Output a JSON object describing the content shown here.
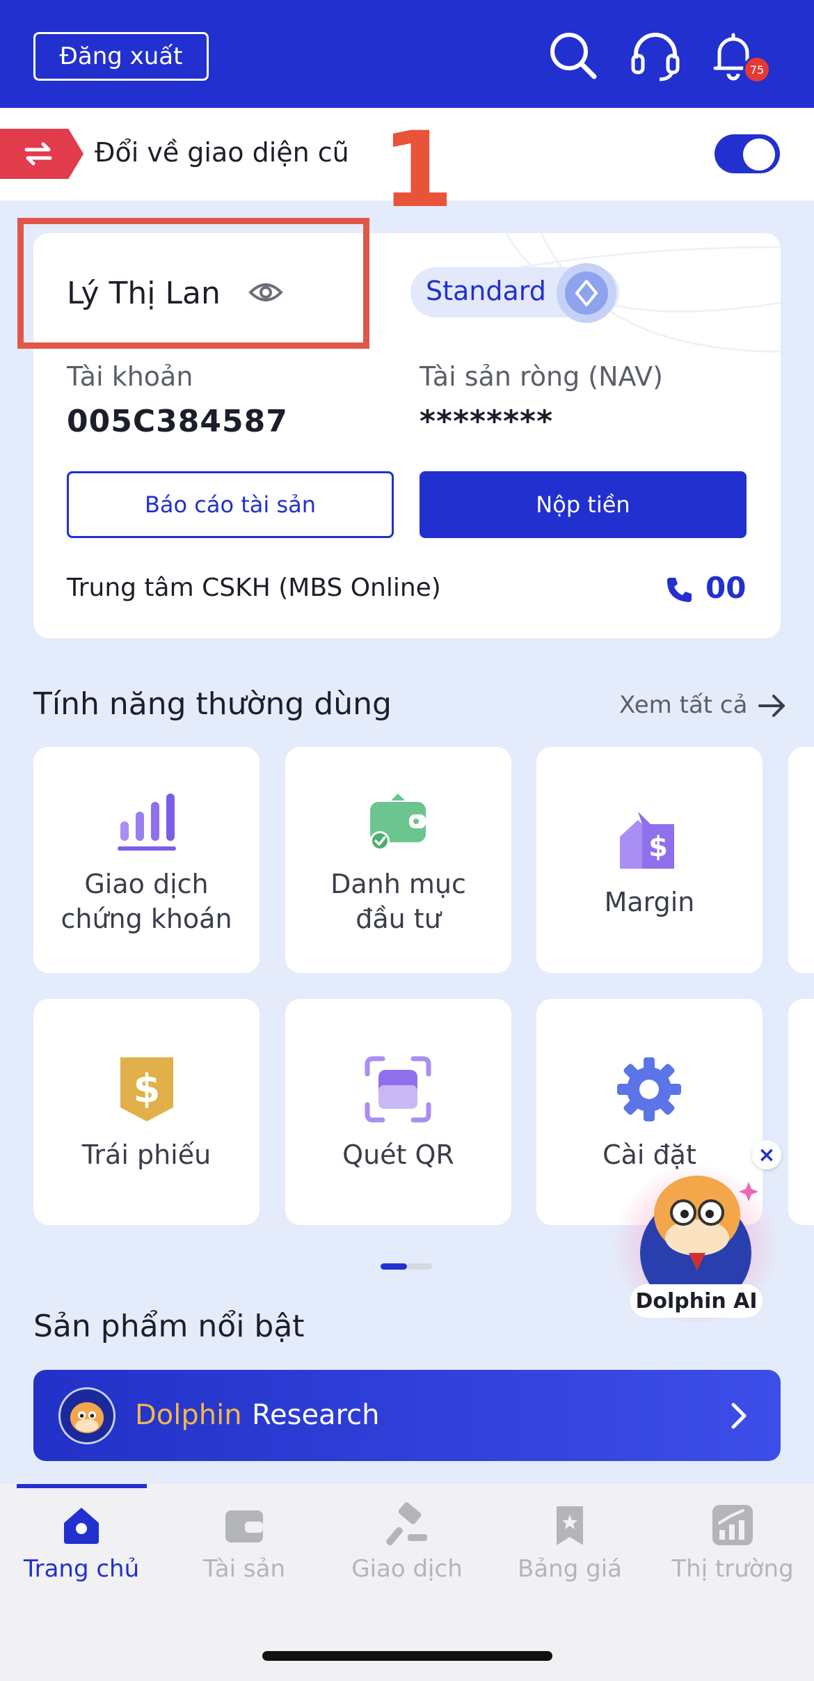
{
  "header": {
    "logout_label": "Đăng xuất",
    "notification_count": "75"
  },
  "switch_bar": {
    "label": "Đổi về giao diện cũ",
    "toggle_on": true
  },
  "annotation": {
    "step_number": "1"
  },
  "account": {
    "name": "Lý Thị Lan",
    "tier": "Standard",
    "account_label": "Tài khoản",
    "account_number": "005C384587",
    "nav_label": "Tài sản ròng (NAV)",
    "nav_value": "********",
    "report_button": "Báo cáo tài sản",
    "deposit_button": "Nộp tiền",
    "support_label": "Trung tâm CSKH (MBS Online)",
    "support_number": "00"
  },
  "features": {
    "title": "Tính năng thường dùng",
    "see_all": "Xem tất cả",
    "items": [
      {
        "line1": "Giao dịch",
        "line2": "chứng khoán",
        "icon": "bar-chart-icon"
      },
      {
        "line1": "Danh mục",
        "line2": "đầu tư",
        "icon": "wallet-icon"
      },
      {
        "line1": "Margin",
        "line2": "",
        "icon": "margin-house-icon"
      },
      {
        "line1": "Trái phiếu",
        "line2": "",
        "icon": "bond-dollar-icon"
      },
      {
        "line1": "Quét QR",
        "line2": "",
        "icon": "qr-scan-icon"
      },
      {
        "line1": "Cài đặt",
        "line2": "",
        "icon": "gear-icon"
      }
    ]
  },
  "featured": {
    "title": "Sản phẩm nổi bật",
    "banner_word1": "Dolphin",
    "banner_word2": "Research"
  },
  "dolphin_ai": {
    "label": "Dolphin AI",
    "close": "×"
  },
  "tabs": [
    {
      "label": "Trang chủ",
      "active": true,
      "icon": "home-icon"
    },
    {
      "label": "Tài sản",
      "active": false,
      "icon": "wallet-icon"
    },
    {
      "label": "Giao dịch",
      "active": false,
      "icon": "gavel-icon"
    },
    {
      "label": "Bảng giá",
      "active": false,
      "icon": "bookmark-star-icon"
    },
    {
      "label": "Thị trường",
      "active": false,
      "icon": "market-chart-icon"
    }
  ],
  "colors": {
    "primary": "#2130cf",
    "accent_red": "#e23b4c",
    "annotation_red": "#e0574a",
    "background": "#e4ebfa"
  }
}
